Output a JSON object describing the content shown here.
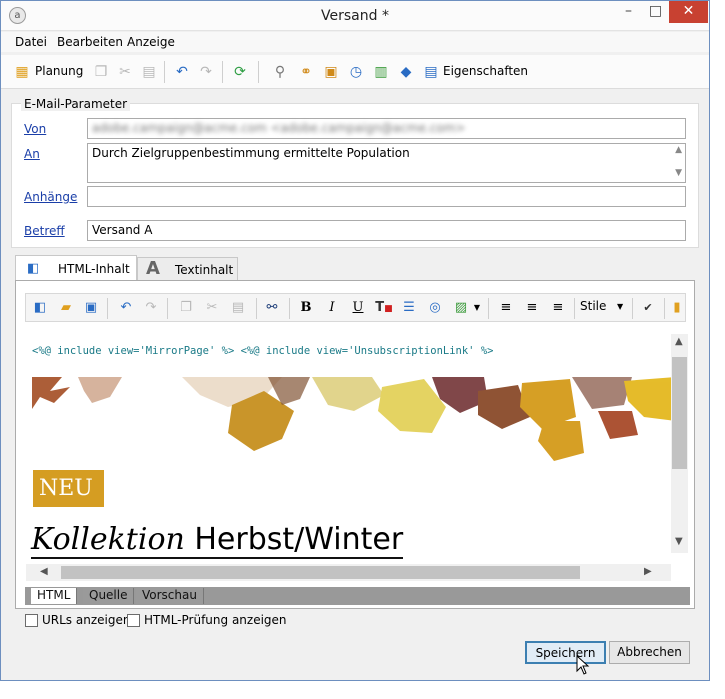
{
  "window": {
    "title": "Versand *",
    "app_icon": "adobe-icon"
  },
  "window_controls": {
    "minimize": "–",
    "maximize": "□",
    "close": "✕"
  },
  "menu": [
    "Datei",
    "Bearbeiten",
    "Anzeige"
  ],
  "toolbar": {
    "planung_label": "Planung",
    "eigenschaften_label": "Eigenschaften"
  },
  "email_params": {
    "legend": "E-Mail-Parameter",
    "von_label": "Von",
    "von_value": "adobe.campaign@acme.com <adobe.campaign@acme.com>",
    "an_label": "An",
    "an_value": "Durch Zielgruppenbestimmung ermittelte Population",
    "anhaenge_label": "Anhänge",
    "anhaenge_value": "",
    "betreff_label": "Betreff",
    "betreff_value": "Versand A"
  },
  "content_tabs": {
    "html": "HTML-Inhalt",
    "text": "Textinhalt"
  },
  "editor_toolbar": {
    "bold": "B",
    "italic": "I",
    "underline": "U",
    "styles_label": "Stile"
  },
  "content": {
    "include_line": "<%@ include view='MirrorPage' %> <%@ include view='UnsubscriptionLink' %>",
    "badge": "NEU",
    "headline_italic": "Kollektion",
    "headline_rest": "Herbst/Winter"
  },
  "bottom_tabs": [
    "HTML",
    "Quelle",
    "Vorschau"
  ],
  "options": {
    "urls_label": "URLs anzeigen",
    "html_check_label": "HTML-Prüfung anzeigen"
  },
  "buttons": {
    "save": "Speichern",
    "cancel": "Abbrechen"
  },
  "colors": {
    "accent": "#3c7fb1",
    "badge": "#d59d22",
    "close": "#c84131",
    "code": "#1a7a87"
  }
}
